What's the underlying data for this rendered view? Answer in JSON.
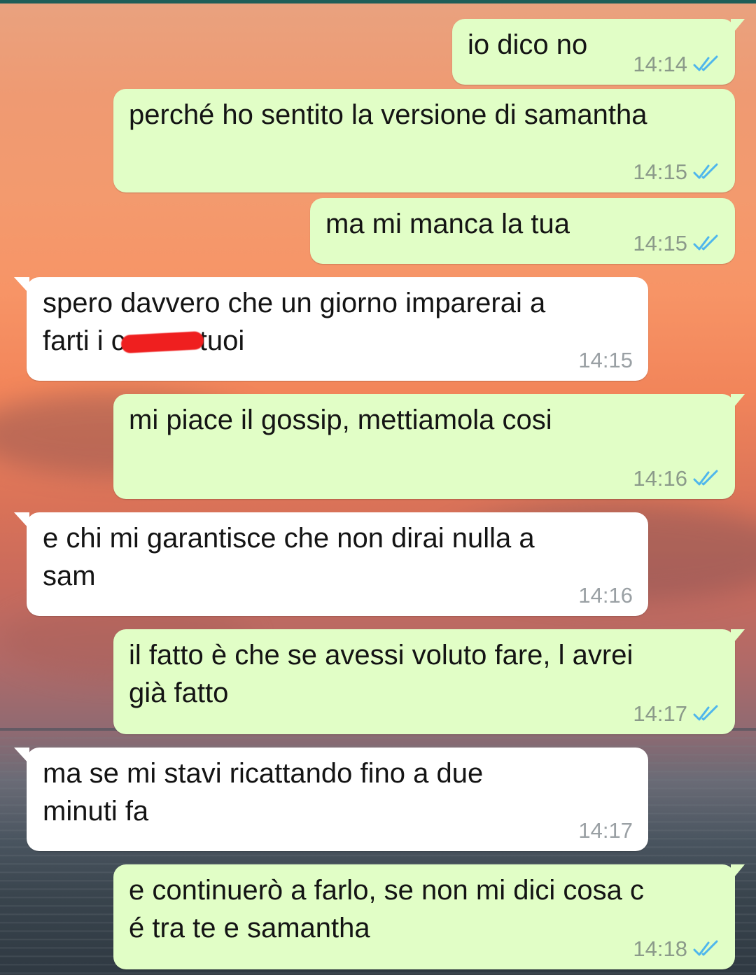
{
  "messages": [
    {
      "direction": "out",
      "text": "io dico no",
      "time": "14:14",
      "status": "read"
    },
    {
      "direction": "out",
      "text": "perché ho sentito la versione di samantha",
      "time": "14:15",
      "status": "read"
    },
    {
      "direction": "out",
      "text": "ma mi manca la tua",
      "time": "14:15",
      "status": "read"
    },
    {
      "direction": "in",
      "text_line1": "spero davvero che un giorno imparerai a",
      "text_line2_before": "farti i c",
      "text_line2_after": "tuoi",
      "time": "14:15"
    },
    {
      "direction": "out",
      "text": "mi piace il gossip, mettiamola cosi",
      "time": "14:16",
      "status": "read"
    },
    {
      "direction": "in",
      "text": "e chi mi garantisce che non dirai nulla a\nsam",
      "time": "14:16"
    },
    {
      "direction": "out",
      "text": "il fatto è che se avessi voluto fare, l avrei\ngià fatto",
      "time": "14:17",
      "status": "read"
    },
    {
      "direction": "in",
      "text": "ma se mi stavi ricattando fino a due\nminuti fa",
      "time": "14:17"
    },
    {
      "direction": "out",
      "text": "e continuerò a farlo, se non mi dici cosa c\né tra te e samantha",
      "time": "14:18",
      "status": "read"
    }
  ],
  "colors": {
    "outgoing_bubble": "#e1fec6",
    "incoming_bubble": "#ffffff",
    "read_ticks": "#4fb6ec",
    "redaction": "#ef1f1f"
  },
  "icons": {
    "read_receipt": "double-check-icon",
    "redaction_mark": "red-scribble"
  }
}
